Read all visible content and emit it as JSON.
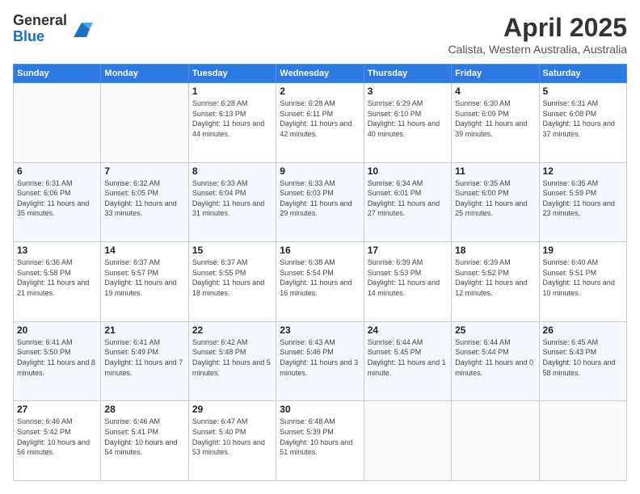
{
  "logo": {
    "general": "General",
    "blue": "Blue"
  },
  "title": "April 2025",
  "subtitle": "Calista, Western Australia, Australia",
  "headers": [
    "Sunday",
    "Monday",
    "Tuesday",
    "Wednesday",
    "Thursday",
    "Friday",
    "Saturday"
  ],
  "weeks": [
    [
      {
        "day": "",
        "sunrise": "",
        "sunset": "",
        "daylight": ""
      },
      {
        "day": "",
        "sunrise": "",
        "sunset": "",
        "daylight": ""
      },
      {
        "day": "1",
        "sunrise": "Sunrise: 6:28 AM",
        "sunset": "Sunset: 6:13 PM",
        "daylight": "Daylight: 11 hours and 44 minutes."
      },
      {
        "day": "2",
        "sunrise": "Sunrise: 6:28 AM",
        "sunset": "Sunset: 6:11 PM",
        "daylight": "Daylight: 11 hours and 42 minutes."
      },
      {
        "day": "3",
        "sunrise": "Sunrise: 6:29 AM",
        "sunset": "Sunset: 6:10 PM",
        "daylight": "Daylight: 11 hours and 40 minutes."
      },
      {
        "day": "4",
        "sunrise": "Sunrise: 6:30 AM",
        "sunset": "Sunset: 6:09 PM",
        "daylight": "Daylight: 11 hours and 39 minutes."
      },
      {
        "day": "5",
        "sunrise": "Sunrise: 6:31 AM",
        "sunset": "Sunset: 6:08 PM",
        "daylight": "Daylight: 11 hours and 37 minutes."
      }
    ],
    [
      {
        "day": "6",
        "sunrise": "Sunrise: 6:31 AM",
        "sunset": "Sunset: 6:06 PM",
        "daylight": "Daylight: 11 hours and 35 minutes."
      },
      {
        "day": "7",
        "sunrise": "Sunrise: 6:32 AM",
        "sunset": "Sunset: 6:05 PM",
        "daylight": "Daylight: 11 hours and 33 minutes."
      },
      {
        "day": "8",
        "sunrise": "Sunrise: 6:33 AM",
        "sunset": "Sunset: 6:04 PM",
        "daylight": "Daylight: 11 hours and 31 minutes."
      },
      {
        "day": "9",
        "sunrise": "Sunrise: 6:33 AM",
        "sunset": "Sunset: 6:03 PM",
        "daylight": "Daylight: 11 hours and 29 minutes."
      },
      {
        "day": "10",
        "sunrise": "Sunrise: 6:34 AM",
        "sunset": "Sunset: 6:01 PM",
        "daylight": "Daylight: 11 hours and 27 minutes."
      },
      {
        "day": "11",
        "sunrise": "Sunrise: 6:35 AM",
        "sunset": "Sunset: 6:00 PM",
        "daylight": "Daylight: 11 hours and 25 minutes."
      },
      {
        "day": "12",
        "sunrise": "Sunrise: 6:35 AM",
        "sunset": "Sunset: 5:59 PM",
        "daylight": "Daylight: 11 hours and 23 minutes."
      }
    ],
    [
      {
        "day": "13",
        "sunrise": "Sunrise: 6:36 AM",
        "sunset": "Sunset: 5:58 PM",
        "daylight": "Daylight: 11 hours and 21 minutes."
      },
      {
        "day": "14",
        "sunrise": "Sunrise: 6:37 AM",
        "sunset": "Sunset: 5:57 PM",
        "daylight": "Daylight: 11 hours and 19 minutes."
      },
      {
        "day": "15",
        "sunrise": "Sunrise: 6:37 AM",
        "sunset": "Sunset: 5:55 PM",
        "daylight": "Daylight: 11 hours and 18 minutes."
      },
      {
        "day": "16",
        "sunrise": "Sunrise: 6:38 AM",
        "sunset": "Sunset: 5:54 PM",
        "daylight": "Daylight: 11 hours and 16 minutes."
      },
      {
        "day": "17",
        "sunrise": "Sunrise: 6:39 AM",
        "sunset": "Sunset: 5:53 PM",
        "daylight": "Daylight: 11 hours and 14 minutes."
      },
      {
        "day": "18",
        "sunrise": "Sunrise: 6:39 AM",
        "sunset": "Sunset: 5:52 PM",
        "daylight": "Daylight: 11 hours and 12 minutes."
      },
      {
        "day": "19",
        "sunrise": "Sunrise: 6:40 AM",
        "sunset": "Sunset: 5:51 PM",
        "daylight": "Daylight: 11 hours and 10 minutes."
      }
    ],
    [
      {
        "day": "20",
        "sunrise": "Sunrise: 6:41 AM",
        "sunset": "Sunset: 5:50 PM",
        "daylight": "Daylight: 11 hours and 8 minutes."
      },
      {
        "day": "21",
        "sunrise": "Sunrise: 6:41 AM",
        "sunset": "Sunset: 5:49 PM",
        "daylight": "Daylight: 11 hours and 7 minutes."
      },
      {
        "day": "22",
        "sunrise": "Sunrise: 6:42 AM",
        "sunset": "Sunset: 5:48 PM",
        "daylight": "Daylight: 11 hours and 5 minutes."
      },
      {
        "day": "23",
        "sunrise": "Sunrise: 6:43 AM",
        "sunset": "Sunset: 5:46 PM",
        "daylight": "Daylight: 11 hours and 3 minutes."
      },
      {
        "day": "24",
        "sunrise": "Sunrise: 6:44 AM",
        "sunset": "Sunset: 5:45 PM",
        "daylight": "Daylight: 11 hours and 1 minute."
      },
      {
        "day": "25",
        "sunrise": "Sunrise: 6:44 AM",
        "sunset": "Sunset: 5:44 PM",
        "daylight": "Daylight: 11 hours and 0 minutes."
      },
      {
        "day": "26",
        "sunrise": "Sunrise: 6:45 AM",
        "sunset": "Sunset: 5:43 PM",
        "daylight": "Daylight: 10 hours and 58 minutes."
      }
    ],
    [
      {
        "day": "27",
        "sunrise": "Sunrise: 6:46 AM",
        "sunset": "Sunset: 5:42 PM",
        "daylight": "Daylight: 10 hours and 56 minutes."
      },
      {
        "day": "28",
        "sunrise": "Sunrise: 6:46 AM",
        "sunset": "Sunset: 5:41 PM",
        "daylight": "Daylight: 10 hours and 54 minutes."
      },
      {
        "day": "29",
        "sunrise": "Sunrise: 6:47 AM",
        "sunset": "Sunset: 5:40 PM",
        "daylight": "Daylight: 10 hours and 53 minutes."
      },
      {
        "day": "30",
        "sunrise": "Sunrise: 6:48 AM",
        "sunset": "Sunset: 5:39 PM",
        "daylight": "Daylight: 10 hours and 51 minutes."
      },
      {
        "day": "",
        "sunrise": "",
        "sunset": "",
        "daylight": ""
      },
      {
        "day": "",
        "sunrise": "",
        "sunset": "",
        "daylight": ""
      },
      {
        "day": "",
        "sunrise": "",
        "sunset": "",
        "daylight": ""
      }
    ]
  ]
}
